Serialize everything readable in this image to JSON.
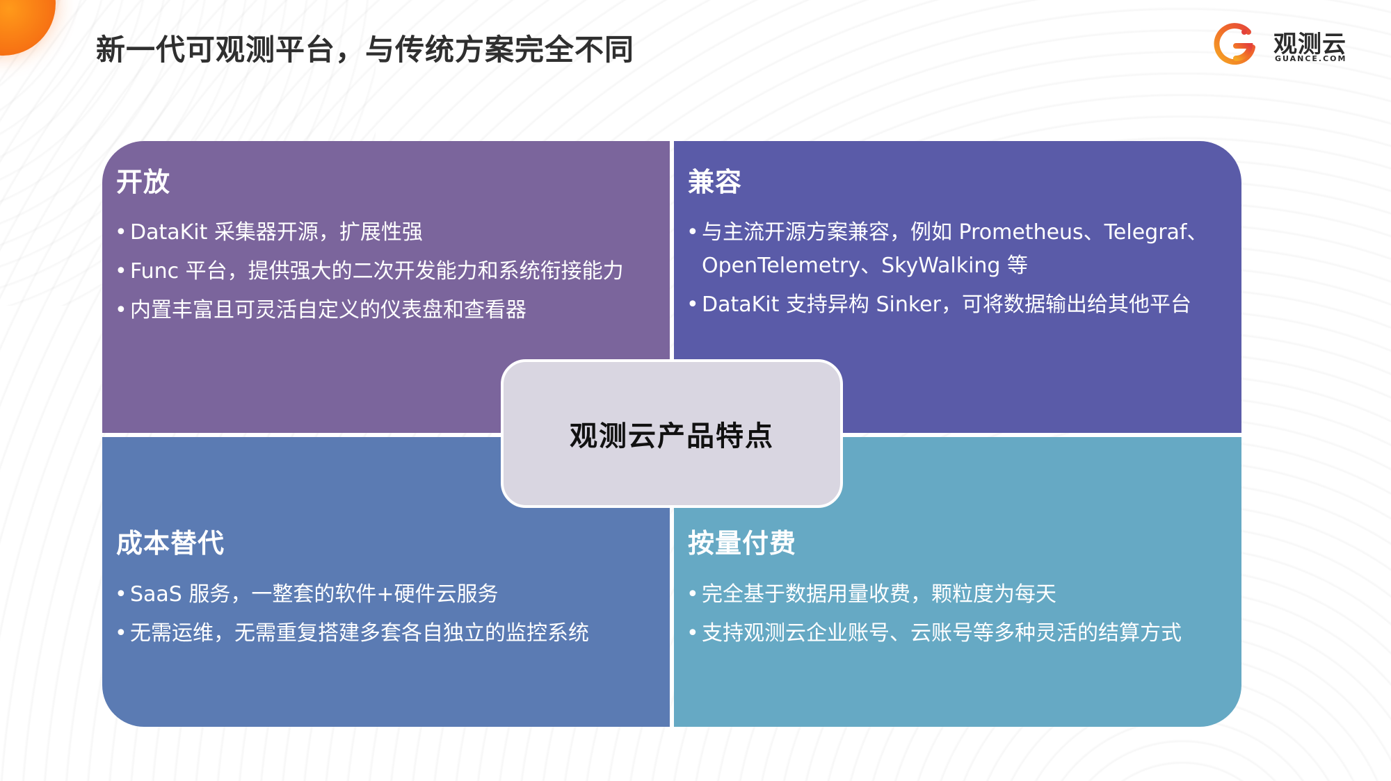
{
  "title": "新一代可观测平台，与传统方案完全不同",
  "logo": {
    "name": "观测云",
    "domain": "GUANCE.COM",
    "colors": [
      "#f5a623",
      "#f06b2a",
      "#e3423b"
    ]
  },
  "center": {
    "label": "观测云产品特点"
  },
  "quadrants": {
    "open": {
      "heading": "开放",
      "color": "#7b659c",
      "items": [
        "DataKit 采集器开源，扩展性强",
        "Func 平台，提供强大的二次开发能力和系统衔接能力",
        "内置丰富且可灵活自定义的仪表盘和查看器"
      ]
    },
    "compat": {
      "heading": "兼容",
      "color": "#5a5ba8",
      "items": [
        "与主流开源方案兼容，例如 Prometheus、Telegraf、OpenTelemetry、SkyWalking 等",
        "DataKit 支持异构 Sinker，可将数据输出给其他平台"
      ]
    },
    "cost": {
      "heading": "成本替代",
      "color": "#5b7bb3",
      "items": [
        "SaaS 服务，一整套的软件+硬件云服务",
        "无需运维，无需重复搭建多套各自独立的监控系统"
      ]
    },
    "pay": {
      "heading": "按量付费",
      "color": "#66a9c4",
      "items": [
        "完全基于数据用量收费，颗粒度为每天",
        "支持观测云企业账号、云账号等多种灵活的结算方式"
      ]
    }
  },
  "bullet": "•"
}
